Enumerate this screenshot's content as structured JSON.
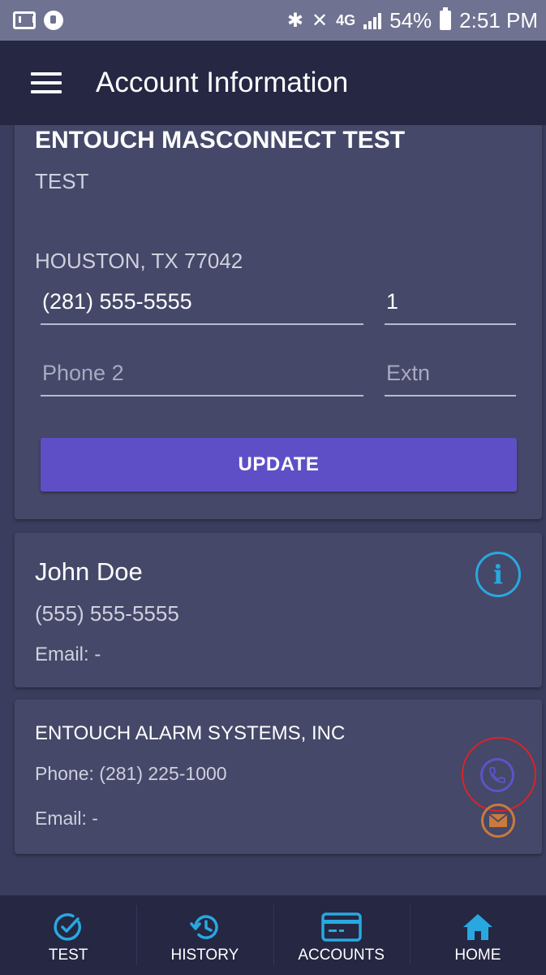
{
  "status_bar": {
    "battery": "54%",
    "time": "2:51 PM",
    "network": "4G"
  },
  "app_bar": {
    "title": "Account Information"
  },
  "account": {
    "name": "ENTOUCH MASCONNECT TEST",
    "line1": "TEST",
    "city_state_zip": "HOUSTON, TX 77042",
    "phone1_value": "(281) 555-5555",
    "ext1_value": "1",
    "phone2_placeholder": "Phone 2",
    "ext2_placeholder": "Extn",
    "update_label": "UPDATE"
  },
  "contact": {
    "name": "John Doe",
    "phone": "(555) 555-5555",
    "email": "Email: -"
  },
  "company": {
    "name": "ENTOUCH ALARM SYSTEMS, INC",
    "phone": "Phone:   (281) 225-1000",
    "email": "Email:   -"
  },
  "bottom_nav": {
    "items": [
      {
        "label": "TEST",
        "icon": "check-circle-icon"
      },
      {
        "label": "HISTORY",
        "icon": "history-icon"
      },
      {
        "label": "ACCOUNTS",
        "icon": "credit-card-icon"
      },
      {
        "label": "HOME",
        "icon": "home-icon"
      }
    ]
  },
  "colors": {
    "accent": "#5f4fc6",
    "info": "#29a8e0",
    "phone": "#5a55c7",
    "mail": "#c97a3c",
    "highlight_ring": "#d9242a",
    "nav_icon": "#29a8e0"
  }
}
